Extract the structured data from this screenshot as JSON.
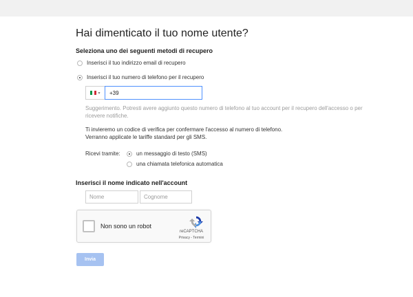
{
  "page": {
    "title": "Hai dimenticato il tuo nome utente?",
    "recovery_heading": "Seleziona uno dei seguenti metodi di recupero",
    "options": [
      {
        "label": "Inserisci il tuo indirizzo email di recupero",
        "selected": false
      },
      {
        "label": "Inserisci il tuo numero di telefono per il recupero",
        "selected": true
      }
    ],
    "phone": {
      "country": "Italy",
      "value": "+39"
    },
    "hint": "Suggerimento. Potresti avere aggiunto questo numero di telefono al tuo account per il recupero dell'accesso o per ricevere notifiche.",
    "info_line1": "Ti invieremo un codice di verifica per confermare l'accesso al numero di telefono.",
    "info_line2": "Verranno applicate le tariffe standard per gli SMS.",
    "receive_via_label": "Ricevi tramite:",
    "receive_options": [
      {
        "label": "un messaggio di testo (SMS)",
        "selected": true
      },
      {
        "label": "una chiamata telefonica automatica",
        "selected": false
      }
    ],
    "name_heading": "Inserisci il nome indicato nell'account",
    "first_name_placeholder": "Nome",
    "last_name_placeholder": "Cognome",
    "captcha": {
      "label": "Non sono un robot",
      "brand": "reCAPTCHA",
      "links": "Privacy - Termini"
    },
    "submit_label": "Invia"
  },
  "colors": {
    "accent": "#4d90fe",
    "submit_disabled": "#a6c2f1",
    "hint_text": "#9b9b9b"
  }
}
